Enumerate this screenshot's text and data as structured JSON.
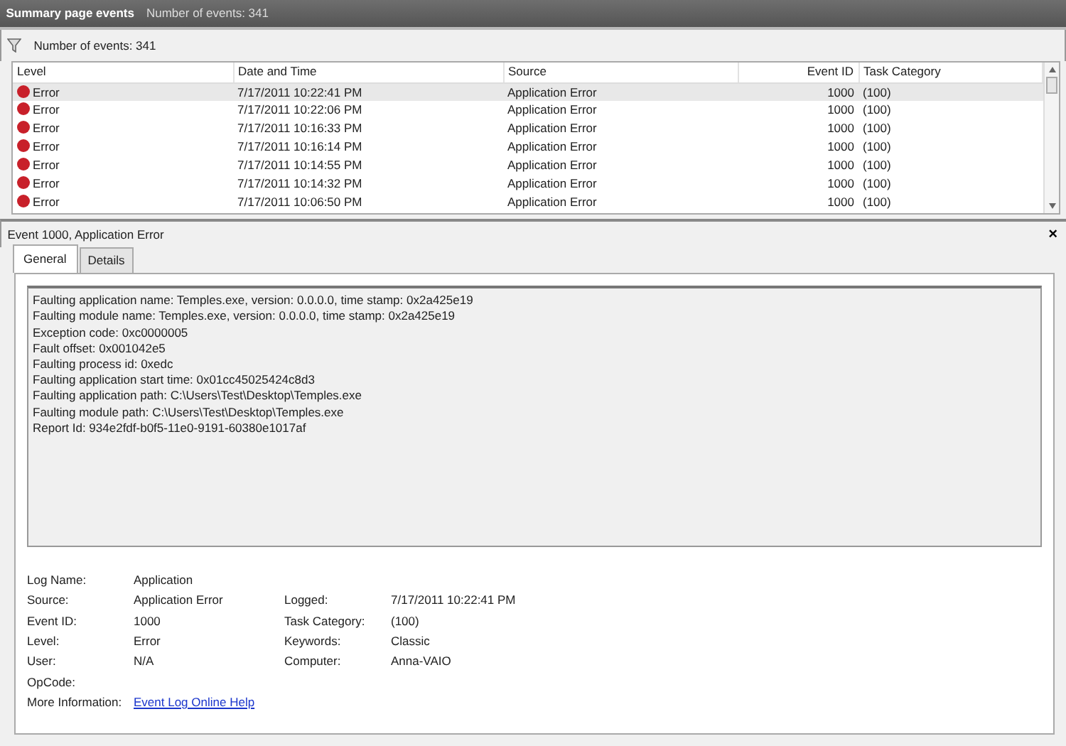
{
  "header": {
    "title": "Summary page events",
    "subtitle": "Number of events: 341"
  },
  "toolbar": {
    "label": "Number of events: 341"
  },
  "table": {
    "columns": [
      "Level",
      "Date and Time",
      "Source",
      "Event ID",
      "Task Category"
    ],
    "rows": [
      {
        "level": "Error",
        "date": "7/17/2011 10:22:41 PM",
        "source": "Application Error",
        "event_id": "1000",
        "task_category": "(100)",
        "selected": true
      },
      {
        "level": "Error",
        "date": "7/17/2011 10:22:06 PM",
        "source": "Application Error",
        "event_id": "1000",
        "task_category": "(100)",
        "selected": false
      },
      {
        "level": "Error",
        "date": "7/17/2011 10:16:33 PM",
        "source": "Application Error",
        "event_id": "1000",
        "task_category": "(100)",
        "selected": false
      },
      {
        "level": "Error",
        "date": "7/17/2011 10:16:14 PM",
        "source": "Application Error",
        "event_id": "1000",
        "task_category": "(100)",
        "selected": false
      },
      {
        "level": "Error",
        "date": "7/17/2011 10:14:55 PM",
        "source": "Application Error",
        "event_id": "1000",
        "task_category": "(100)",
        "selected": false
      },
      {
        "level": "Error",
        "date": "7/17/2011 10:14:32 PM",
        "source": "Application Error",
        "event_id": "1000",
        "task_category": "(100)",
        "selected": false
      },
      {
        "level": "Error",
        "date": "7/17/2011 10:06:50 PM",
        "source": "Application Error",
        "event_id": "1000",
        "task_category": "(100)",
        "selected": false
      }
    ]
  },
  "detail": {
    "title": "Event 1000, Application Error",
    "close": "×",
    "tabs": [
      {
        "label": "General",
        "selected": true
      },
      {
        "label": "Details",
        "selected": false
      }
    ],
    "message": [
      "Faulting application name: Temples.exe, version: 0.0.0.0, time stamp: 0x2a425e19",
      "Faulting module name: Temples.exe, version: 0.0.0.0, time stamp: 0x2a425e19",
      "Exception code: 0xc0000005",
      "Fault offset: 0x001042e5",
      "Faulting process id: 0xedc",
      "Faulting application start time: 0x01cc45025424c8d3",
      "Faulting application path: C:\\Users\\Test\\Desktop\\Temples.exe",
      "Faulting module path: C:\\Users\\Test\\Desktop\\Temples.exe",
      "Report Id: 934e2fdf-b0f5-11e0-9191-60380e1017af"
    ],
    "properties": [
      {
        "label": "Log Name:",
        "value": "Application"
      },
      {
        "label": "Source:",
        "value": "Application Error",
        "right_label": "Logged:",
        "right_value": "7/17/2011 10:22:41 PM"
      },
      {
        "label": "Event ID:",
        "value": "1000",
        "right_label": "Task Category:",
        "right_value": "(100)"
      },
      {
        "label": "Level:",
        "value": "Error",
        "right_label": "Keywords:",
        "right_value": "Classic"
      },
      {
        "label": "User:",
        "value": "N/A",
        "right_label": "Computer:",
        "right_value": "Anna-VAIO"
      },
      {
        "label": "OpCode:"
      },
      {
        "label": "More Information:",
        "link": "Event Log Online Help"
      }
    ]
  }
}
